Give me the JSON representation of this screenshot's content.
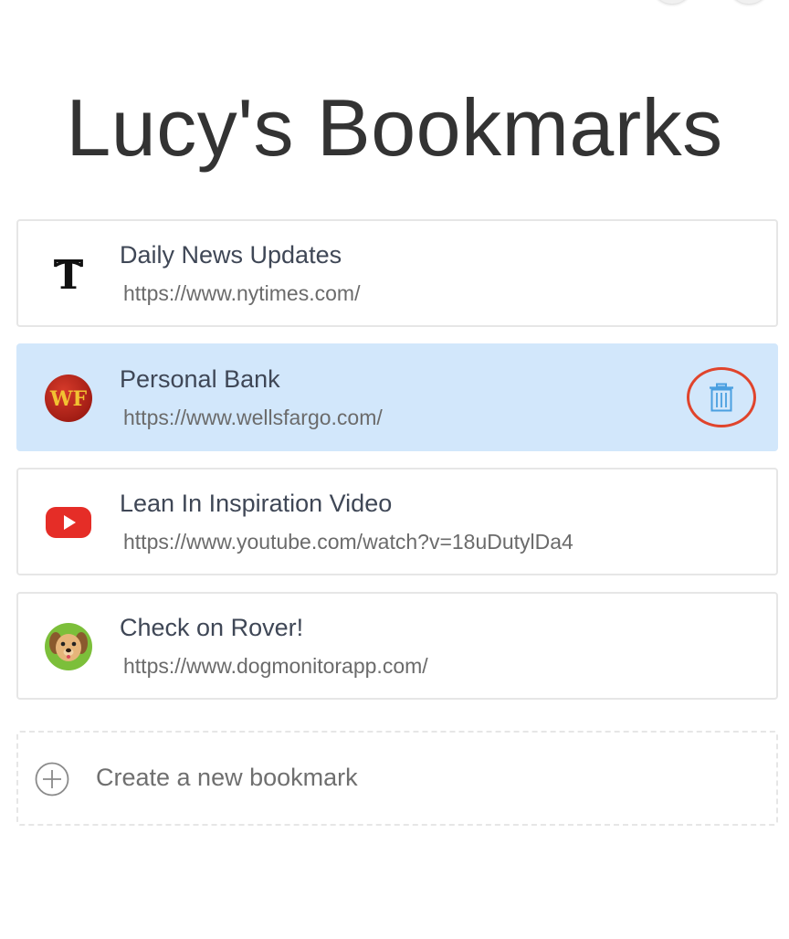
{
  "header": {
    "title": "Lucy's Bookmarks"
  },
  "bookmarks": [
    {
      "title": "Daily News Updates",
      "url": "https://www.nytimes.com/",
      "icon": "nytimes-logo-icon",
      "selected": false
    },
    {
      "title": "Personal Bank",
      "url": "https://www.wellsfargo.com/",
      "icon": "wellsfargo-logo-icon",
      "icon_text": "WF",
      "selected": true
    },
    {
      "title": "Lean In Inspiration Video",
      "url": "https://www.youtube.com/watch?v=18uDutylDa4",
      "icon": "youtube-logo-icon",
      "selected": false
    },
    {
      "title": "Check on Rover!",
      "url": "https://www.dogmonitorapp.com/",
      "icon": "dog-face-icon",
      "selected": false
    }
  ],
  "create": {
    "label": "Create a new bookmark",
    "icon": "plus-circle-icon"
  },
  "colors": {
    "selected_background": "#d2e7fb",
    "delete_icon": "#4a9fe0",
    "highlight_ring": "#e0442c",
    "title_text": "#3f4756",
    "url_text": "#6b6b6b"
  }
}
